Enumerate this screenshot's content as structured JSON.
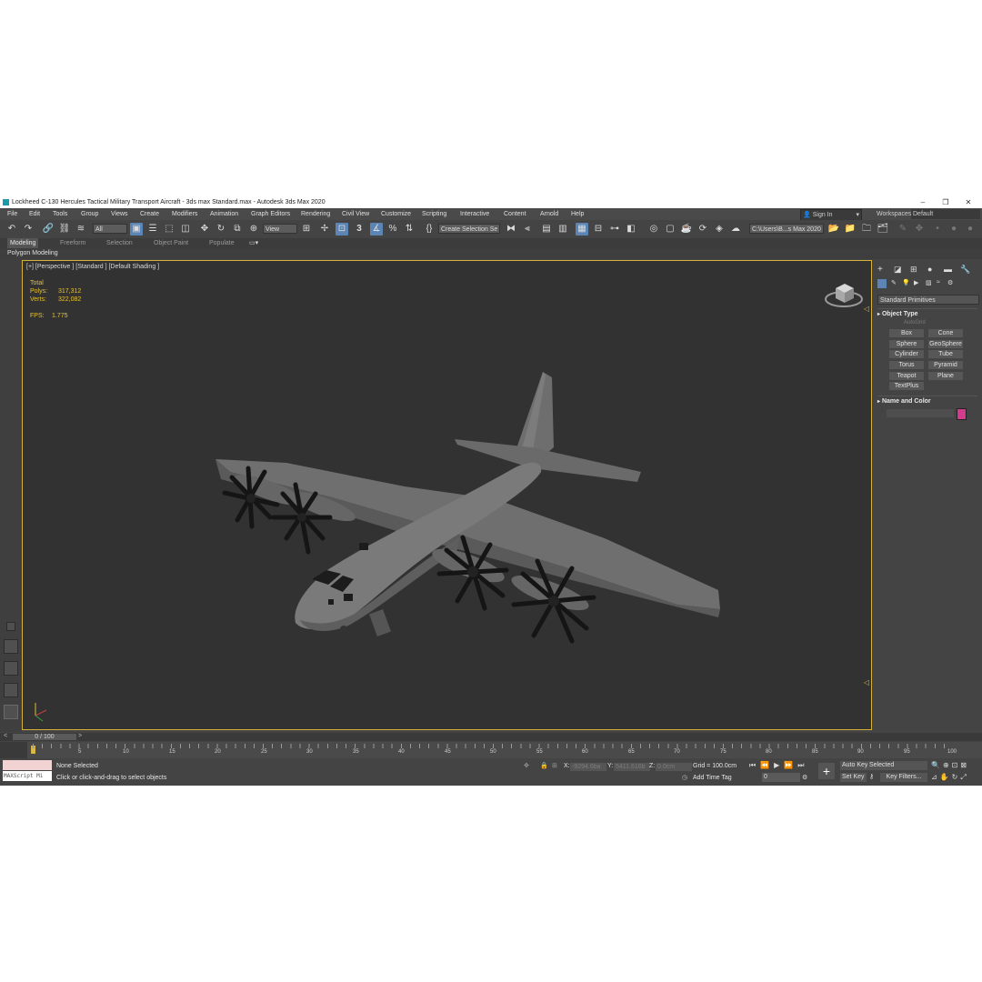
{
  "window": {
    "title": "Lockheed C-130 Hercules Tactical Military Transport Aircraft - 3ds max Standard.max - Autodesk 3ds Max 2020",
    "minimize": "–",
    "maximize": "❐",
    "close": "✕"
  },
  "menu": [
    "File",
    "Edit",
    "Tools",
    "Group",
    "Views",
    "Create",
    "Modifiers",
    "Animation",
    "Graph Editors",
    "Rendering",
    "Civil View",
    "Customize",
    "Scripting",
    "Interactive",
    "Content",
    "Arnold",
    "Help"
  ],
  "account": {
    "sign_in": "Sign In",
    "workspaces_label": "Workspaces:",
    "workspace": "Default"
  },
  "toolbar": {
    "selection_filter": "All",
    "ref_coord": "View",
    "selection_set": "Create Selection Se",
    "project_path": "C:\\Users\\B...s Max 2020",
    "snap_number": "3"
  },
  "ribbon": {
    "tabs": [
      "Modeling",
      "Freeform",
      "Selection",
      "Object Paint",
      "Populate"
    ],
    "active": "Modeling",
    "subpanel": "Polygon Modeling"
  },
  "viewport": {
    "label": "[+] [Perspective ] [Standard ] [Default Shading ]",
    "stats": {
      "header": "Total",
      "polys_label": "Polys:",
      "polys": "317,312",
      "verts_label": "Verts:",
      "verts": "322,082",
      "fps_label": "FPS:",
      "fps": "1.775"
    }
  },
  "command_panel": {
    "category": "Standard Primitives",
    "object_type": "Object Type",
    "autogrid": "AutoGrid",
    "buttons": [
      "Box",
      "Cone",
      "Sphere",
      "GeoSphere",
      "Cylinder",
      "Tube",
      "Torus",
      "Pyramid",
      "Teapot",
      "Plane",
      "TextPlus"
    ],
    "name_and_color": "Name and Color",
    "object_color": "#d33b8d"
  },
  "timeline": {
    "frame": "0 / 100",
    "ticks": [
      "0",
      "5",
      "10",
      "15",
      "20",
      "25",
      "30",
      "35",
      "40",
      "45",
      "50",
      "55",
      "60",
      "65",
      "70",
      "75",
      "80",
      "85",
      "90",
      "95",
      "100"
    ]
  },
  "status": {
    "maxscript": "MAXScript Mi",
    "selection": "None Selected",
    "prompt": "Click or click-and-drag to select objects",
    "x_label": "X:",
    "x": "-9294.6ba",
    "y_label": "Y:",
    "y": "5411.616b",
    "z_label": "Z:",
    "z": "0.0cm",
    "grid": "Grid = 100.0cm",
    "add_time_tag": "Add Time Tag",
    "auto_key": "Auto Key",
    "set_key": "Set Key",
    "key_mode": "Selected",
    "key_filters": "Key Filters...",
    "current_frame": "0"
  }
}
